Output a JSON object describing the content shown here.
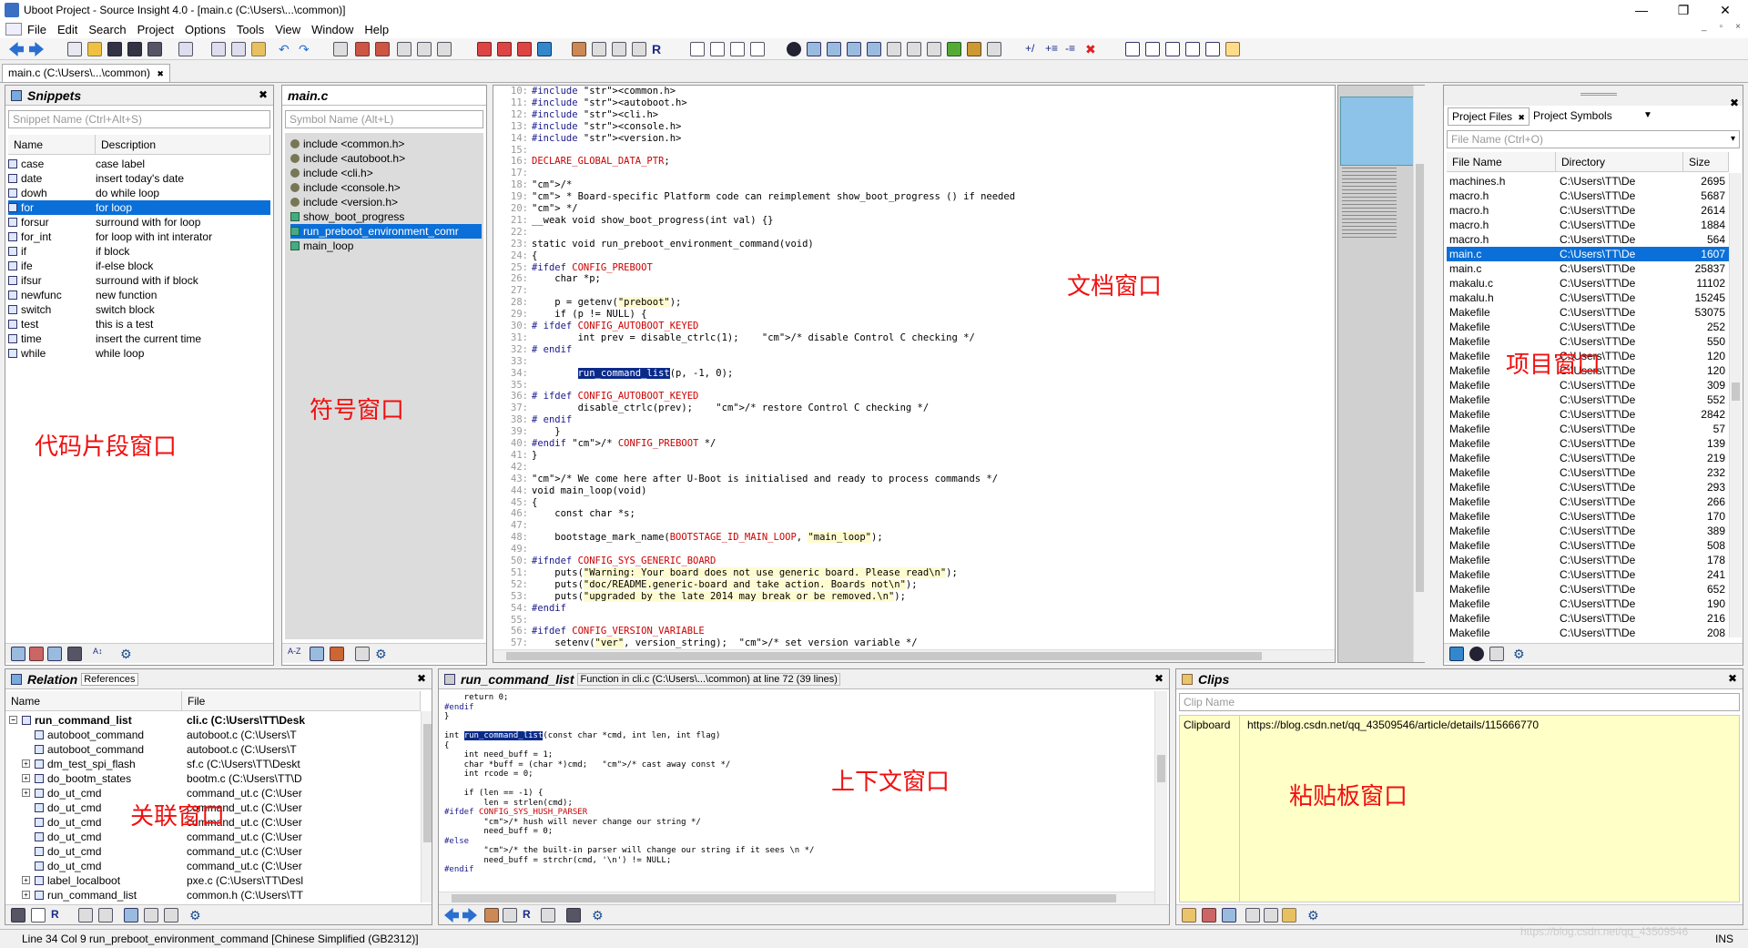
{
  "window": {
    "title": "Uboot Project - Source Insight 4.0 - [main.c (C:\\Users\\...\\common)]"
  },
  "menu": [
    "File",
    "Edit",
    "Search",
    "Project",
    "Options",
    "Tools",
    "View",
    "Window",
    "Help"
  ],
  "filetab": {
    "label": "main.c (C:\\Users\\...\\common)",
    "close": "✖"
  },
  "snippets": {
    "title": "Snippets",
    "placeholder": "Snippet Name (Ctrl+Alt+S)",
    "col_name": "Name",
    "col_desc": "Description",
    "rows": [
      {
        "name": "case",
        "desc": "case label"
      },
      {
        "name": "date",
        "desc": "insert today's date"
      },
      {
        "name": "dowh",
        "desc": "do while loop"
      },
      {
        "name": "for",
        "desc": "for loop"
      },
      {
        "name": "forsur",
        "desc": "surround with for loop"
      },
      {
        "name": "for_int",
        "desc": "for loop with int interator"
      },
      {
        "name": "if",
        "desc": "if block"
      },
      {
        "name": "ife",
        "desc": "if-else block"
      },
      {
        "name": "ifsur",
        "desc": "surround with if block"
      },
      {
        "name": "newfunc",
        "desc": "new function"
      },
      {
        "name": "switch",
        "desc": "switch block"
      },
      {
        "name": "test",
        "desc": "this is a test"
      },
      {
        "name": "time",
        "desc": "insert the current time"
      },
      {
        "name": "while",
        "desc": "while loop"
      }
    ],
    "annotation": "代码片段窗口"
  },
  "symbols": {
    "title": "main.c",
    "placeholder": "Symbol Name (Alt+L)",
    "items": [
      "include <common.h>",
      "include <autoboot.h>",
      "include <cli.h>",
      "include <console.h>",
      "include <version.h>",
      "show_boot_progress",
      "run_preboot_environment_comr",
      "main_loop"
    ],
    "annotation": "符号窗口"
  },
  "editor": {
    "annotation": "文档窗口",
    "lines": [
      {
        "n": "10",
        "t": "#include <common.h>"
      },
      {
        "n": "11",
        "t": "#include <autoboot.h>"
      },
      {
        "n": "12",
        "t": "#include <cli.h>"
      },
      {
        "n": "13",
        "t": "#include <console.h>"
      },
      {
        "n": "14",
        "t": "#include <version.h>"
      },
      {
        "n": "15",
        "t": ""
      },
      {
        "n": "16",
        "t": "DECLARE_GLOBAL_DATA_PTR;"
      },
      {
        "n": "17",
        "t": ""
      },
      {
        "n": "18",
        "t": "/*"
      },
      {
        "n": "19",
        "t": " * Board-specific Platform code can reimplement show_boot_progress () if needed"
      },
      {
        "n": "20",
        "t": " */"
      },
      {
        "n": "21",
        "t": "__weak void show_boot_progress(int val) {}"
      },
      {
        "n": "22",
        "t": ""
      },
      {
        "n": "23",
        "t": "static void run_preboot_environment_command(void)"
      },
      {
        "n": "24",
        "t": "{"
      },
      {
        "n": "25",
        "t": "#ifdef CONFIG_PREBOOT"
      },
      {
        "n": "26",
        "t": "    char *p;"
      },
      {
        "n": "27",
        "t": ""
      },
      {
        "n": "28",
        "t": "    p = getenv(\"preboot\");"
      },
      {
        "n": "29",
        "t": "    if (p != NULL) {"
      },
      {
        "n": "30",
        "t": "# ifdef CONFIG_AUTOBOOT_KEYED"
      },
      {
        "n": "31",
        "t": "        int prev = disable_ctrlc(1);    /* disable Control C checking */"
      },
      {
        "n": "32",
        "t": "# endif"
      },
      {
        "n": "33",
        "t": ""
      },
      {
        "n": "34",
        "t": "        run_command_list(p, -1, 0);"
      },
      {
        "n": "35",
        "t": ""
      },
      {
        "n": "36",
        "t": "# ifdef CONFIG_AUTOBOOT_KEYED"
      },
      {
        "n": "37",
        "t": "        disable_ctrlc(prev);    /* restore Control C checking */"
      },
      {
        "n": "38",
        "t": "# endif"
      },
      {
        "n": "39",
        "t": "    }"
      },
      {
        "n": "40",
        "t": "#endif /* CONFIG_PREBOOT */"
      },
      {
        "n": "41",
        "t": "}"
      },
      {
        "n": "42",
        "t": ""
      },
      {
        "n": "43",
        "t": "/* We come here after U-Boot is initialised and ready to process commands */"
      },
      {
        "n": "44",
        "t": "void main_loop(void)"
      },
      {
        "n": "45",
        "t": "{"
      },
      {
        "n": "46",
        "t": "    const char *s;"
      },
      {
        "n": "47",
        "t": ""
      },
      {
        "n": "48",
        "t": "    bootstage_mark_name(BOOTSTAGE_ID_MAIN_LOOP, \"main_loop\");"
      },
      {
        "n": "49",
        "t": ""
      },
      {
        "n": "50",
        "t": "#ifndef CONFIG_SYS_GENERIC_BOARD"
      },
      {
        "n": "51",
        "t": "    puts(\"Warning: Your board does not use generic board. Please read\\n\");"
      },
      {
        "n": "52",
        "t": "    puts(\"doc/README.generic-board and take action. Boards not\\n\");"
      },
      {
        "n": "53",
        "t": "    puts(\"upgraded by the late 2014 may break or be removed.\\n\");"
      },
      {
        "n": "54",
        "t": "#endif"
      },
      {
        "n": "55",
        "t": ""
      },
      {
        "n": "56",
        "t": "#ifdef CONFIG_VERSION_VARIABLE"
      },
      {
        "n": "57",
        "t": "    setenv(\"ver\", version_string);  /* set version variable */"
      }
    ]
  },
  "project": {
    "tab1": "Project Files",
    "tab2": "Project Symbols",
    "placeholder": "File Name (Ctrl+O)",
    "col_name": "File Name",
    "col_dir": "Directory",
    "col_size": "Size",
    "annotation": "项目窗口",
    "rows": [
      {
        "name": "machines.h",
        "dir": "C:\\Users\\TT\\De",
        "size": "2695"
      },
      {
        "name": "macro.h",
        "dir": "C:\\Users\\TT\\De",
        "size": "5687"
      },
      {
        "name": "macro.h",
        "dir": "C:\\Users\\TT\\De",
        "size": "2614"
      },
      {
        "name": "macro.h",
        "dir": "C:\\Users\\TT\\De",
        "size": "1884"
      },
      {
        "name": "macro.h",
        "dir": "C:\\Users\\TT\\De",
        "size": "564"
      },
      {
        "name": "main.c",
        "dir": "C:\\Users\\TT\\De",
        "size": "1607"
      },
      {
        "name": "main.c",
        "dir": "C:\\Users\\TT\\De",
        "size": "25837"
      },
      {
        "name": "makalu.c",
        "dir": "C:\\Users\\TT\\De",
        "size": "11102"
      },
      {
        "name": "makalu.h",
        "dir": "C:\\Users\\TT\\De",
        "size": "15245"
      },
      {
        "name": "Makefile",
        "dir": "C:\\Users\\TT\\De",
        "size": "53075"
      },
      {
        "name": "Makefile",
        "dir": "C:\\Users\\TT\\De",
        "size": "252"
      },
      {
        "name": "Makefile",
        "dir": "C:\\Users\\TT\\De",
        "size": "550"
      },
      {
        "name": "Makefile",
        "dir": "C:\\Users\\TT\\De",
        "size": "120"
      },
      {
        "name": "Makefile",
        "dir": "C:\\Users\\TT\\De",
        "size": "120"
      },
      {
        "name": "Makefile",
        "dir": "C:\\Users\\TT\\De",
        "size": "309"
      },
      {
        "name": "Makefile",
        "dir": "C:\\Users\\TT\\De",
        "size": "552"
      },
      {
        "name": "Makefile",
        "dir": "C:\\Users\\TT\\De",
        "size": "2842"
      },
      {
        "name": "Makefile",
        "dir": "C:\\Users\\TT\\De",
        "size": "57"
      },
      {
        "name": "Makefile",
        "dir": "C:\\Users\\TT\\De",
        "size": "139"
      },
      {
        "name": "Makefile",
        "dir": "C:\\Users\\TT\\De",
        "size": "219"
      },
      {
        "name": "Makefile",
        "dir": "C:\\Users\\TT\\De",
        "size": "232"
      },
      {
        "name": "Makefile",
        "dir": "C:\\Users\\TT\\De",
        "size": "293"
      },
      {
        "name": "Makefile",
        "dir": "C:\\Users\\TT\\De",
        "size": "266"
      },
      {
        "name": "Makefile",
        "dir": "C:\\Users\\TT\\De",
        "size": "170"
      },
      {
        "name": "Makefile",
        "dir": "C:\\Users\\TT\\De",
        "size": "389"
      },
      {
        "name": "Makefile",
        "dir": "C:\\Users\\TT\\De",
        "size": "508"
      },
      {
        "name": "Makefile",
        "dir": "C:\\Users\\TT\\De",
        "size": "178"
      },
      {
        "name": "Makefile",
        "dir": "C:\\Users\\TT\\De",
        "size": "241"
      },
      {
        "name": "Makefile",
        "dir": "C:\\Users\\TT\\De",
        "size": "652"
      },
      {
        "name": "Makefile",
        "dir": "C:\\Users\\TT\\De",
        "size": "190"
      },
      {
        "name": "Makefile",
        "dir": "C:\\Users\\TT\\De",
        "size": "216"
      },
      {
        "name": "Makefile",
        "dir": "C:\\Users\\TT\\De",
        "size": "208"
      }
    ]
  },
  "relation": {
    "title": "Relation",
    "sub": "References",
    "col_name": "Name",
    "col_file": "File",
    "annotation": "关联窗口",
    "rows": [
      {
        "name": "run_command_list",
        "file": "cli.c (C:\\Users\\TT\\Desk",
        "root": true
      },
      {
        "name": "autoboot_command",
        "file": "autoboot.c (C:\\Users\\T"
      },
      {
        "name": "autoboot_command",
        "file": "autoboot.c (C:\\Users\\T"
      },
      {
        "name": "dm_test_spi_flash",
        "file": "sf.c (C:\\Users\\TT\\Deskt"
      },
      {
        "name": "do_bootm_states",
        "file": "bootm.c (C:\\Users\\TT\\D"
      },
      {
        "name": "do_ut_cmd",
        "file": "command_ut.c (C:\\User"
      },
      {
        "name": "do_ut_cmd",
        "file": "command_ut.c (C:\\User"
      },
      {
        "name": "do_ut_cmd",
        "file": "command_ut.c (C:\\User"
      },
      {
        "name": "do_ut_cmd",
        "file": "command_ut.c (C:\\User"
      },
      {
        "name": "do_ut_cmd",
        "file": "command_ut.c (C:\\User"
      },
      {
        "name": "do_ut_cmd",
        "file": "command_ut.c (C:\\User"
      },
      {
        "name": "label_localboot",
        "file": "pxe.c (C:\\Users\\TT\\Desl"
      },
      {
        "name": "run_command_list",
        "file": "common.h (C:\\Users\\TT"
      }
    ]
  },
  "context": {
    "title": "run_command_list",
    "sub": "Function in cli.c (C:\\Users\\...\\common) at line 72 (39 lines)",
    "annotation": "上下文窗口",
    "lines": [
      "    return 0;",
      "#endif",
      "}",
      "",
      "int run_command_list(const char *cmd, int len, int flag)",
      "{",
      "    int need_buff = 1;",
      "    char *buff = (char *)cmd;   /* cast away const */",
      "    int rcode = 0;",
      "",
      "    if (len == -1) {",
      "        len = strlen(cmd);",
      "#ifdef CONFIG_SYS_HUSH_PARSER",
      "        /* hush will never change our string */",
      "        need_buff = 0;",
      "#else",
      "        /* the built-in parser will change our string if it sees \\n */",
      "        need_buff = strchr(cmd, '\\n') != NULL;",
      "#endif"
    ]
  },
  "clips": {
    "title": "Clips",
    "placeholder": "Clip Name",
    "clip_name": "Clipboard",
    "clip_value": "https://blog.csdn.net/qq_43509546/article/details/115666770",
    "annotation": "粘贴板窗口"
  },
  "status": {
    "text": "Line 34  Col 9   run_preboot_environment_command [Chinese Simplified (GB2312)]",
    "mode": "INS",
    "watermark": "https://blog.csdn.net/qq_43509546"
  }
}
